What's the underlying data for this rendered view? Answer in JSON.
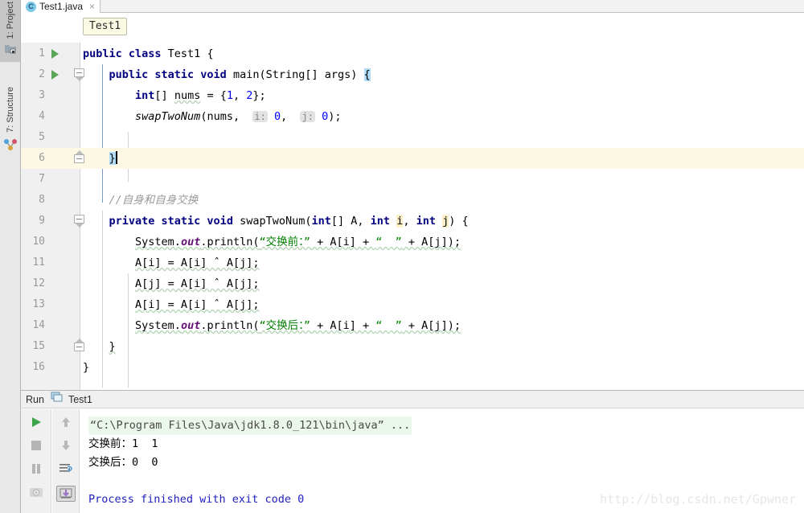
{
  "window": {
    "title": "Test1.java"
  },
  "left_strip": {
    "items": [
      {
        "label": "1: Project",
        "icon": "project-folder-icon",
        "active": true
      },
      {
        "label": "7: Structure",
        "icon": "structure-node-icon",
        "active": false
      }
    ]
  },
  "tab": {
    "label": "Test1.java",
    "icon_letter": "C",
    "close_glyph": "×"
  },
  "breadcrumb": {
    "label": "Test1"
  },
  "editor": {
    "lines": [
      {
        "n": "1",
        "html": "<span class=\"kw\">public class</span> Test1 {"
      },
      {
        "n": "2",
        "html": "    <span class=\"kw\">public static void</span> main(String[] args) <span class=\"brk\">{</span>"
      },
      {
        "n": "3",
        "html": "        <span class=\"kw\">int</span>[] <span class=\"squig\">nums</span> = {<span class=\"num\">1</span>, <span class=\"num\">2</span>};"
      },
      {
        "n": "4",
        "html": "        <span class=\"meth\">swapTwoNum</span>(nums,  <span class=\"hint\">i:</span> <span class=\"num\">0</span>,  <span class=\"hint\">j:</span> <span class=\"num\">0</span>);"
      },
      {
        "n": "5",
        "html": ""
      },
      {
        "n": "6",
        "html": "    <span class=\"brk\">}</span><span class=\"caret\"></span>"
      },
      {
        "n": "7",
        "html": ""
      },
      {
        "n": "8",
        "html": "    <span class=\"cmt\">//自身和自身交换</span>"
      },
      {
        "n": "9",
        "html": "    <span class=\"kw\">private static void</span> swapTwoNum(<span class=\"kw\">int</span>[] A, <span class=\"kw\">int</span> <span class=\"param-hl\">i</span>, <span class=\"kw\">int</span> <span class=\"param-hl\">j</span>) {"
      },
      {
        "n": "10",
        "html": "        <span class=\"squig\">System.<span class=\"stat\">out</span>.println(<span class=\"str\">“交换前：”</span> + A[i] + <span class=\"str\">“  ”</span> + A[j]);</span>"
      },
      {
        "n": "11",
        "html": "        <span class=\"squig\">A[i] = A[i] ˆ A[j];</span>"
      },
      {
        "n": "12",
        "html": "        <span class=\"squig\">A[j] = A[i] ˆ A[j];</span>"
      },
      {
        "n": "13",
        "html": "        <span class=\"squig\">A[i] = A[i] ˆ A[j];</span>"
      },
      {
        "n": "14",
        "html": "        <span class=\"squig\">System.<span class=\"stat\">out</span>.println(<span class=\"str\">“交换后：”</span> + A[i] + <span class=\"str\">“  ”</span> + A[j]);</span>"
      },
      {
        "n": "15",
        "html": "    <span class=\"squig\">}</span>"
      },
      {
        "n": "16",
        "html": "}"
      }
    ],
    "run_arrow_lines": [
      1,
      2
    ],
    "fold_down_lines": [
      2,
      9
    ],
    "fold_up_lines": [
      6,
      15
    ],
    "highlighted_line": 6
  },
  "run_panel": {
    "header_label": "Run",
    "config_name": "Test1",
    "toolbar_left": [
      {
        "icon": "run-icon",
        "name": "rerun-button"
      },
      {
        "icon": "stop-icon",
        "name": "stop-button"
      },
      {
        "icon": "pause-icon",
        "name": "pause-button"
      },
      {
        "icon": "camera-icon",
        "name": "dump-threads-button"
      }
    ],
    "toolbar_right": [
      {
        "icon": "arrow-up-icon",
        "name": "prev-occurrence-button"
      },
      {
        "icon": "arrow-down-icon",
        "name": "next-occurrence-button"
      },
      {
        "icon": "soft-wrap-icon",
        "name": "soft-wrap-button"
      },
      {
        "icon": "scroll-to-end-icon",
        "name": "scroll-to-end-button"
      }
    ],
    "console": [
      {
        "kind": "cmdline",
        "text": "“C:\\Program Files\\Java\\jdk1.8.0_121\\bin\\java” ..."
      },
      {
        "kind": "out",
        "text": "交换前：1  1"
      },
      {
        "kind": "out",
        "text": "交换后：0  0"
      },
      {
        "kind": "exit",
        "text": "Process finished with exit code 0"
      }
    ]
  },
  "watermark": {
    "text": "http://blog.csdn.net/Gpwner"
  },
  "colors": {
    "keyword": "#000080",
    "string": "#008000",
    "number": "#0000ff",
    "comment": "#9a9a9a",
    "static_field": "#660e7a",
    "highlight_line": "#fdf8e3",
    "bracket_match": "#b0dcf8",
    "param_highlight": "#fdf0c8",
    "run_green": "#5aa55a",
    "exit_blue": "#2020c0"
  }
}
